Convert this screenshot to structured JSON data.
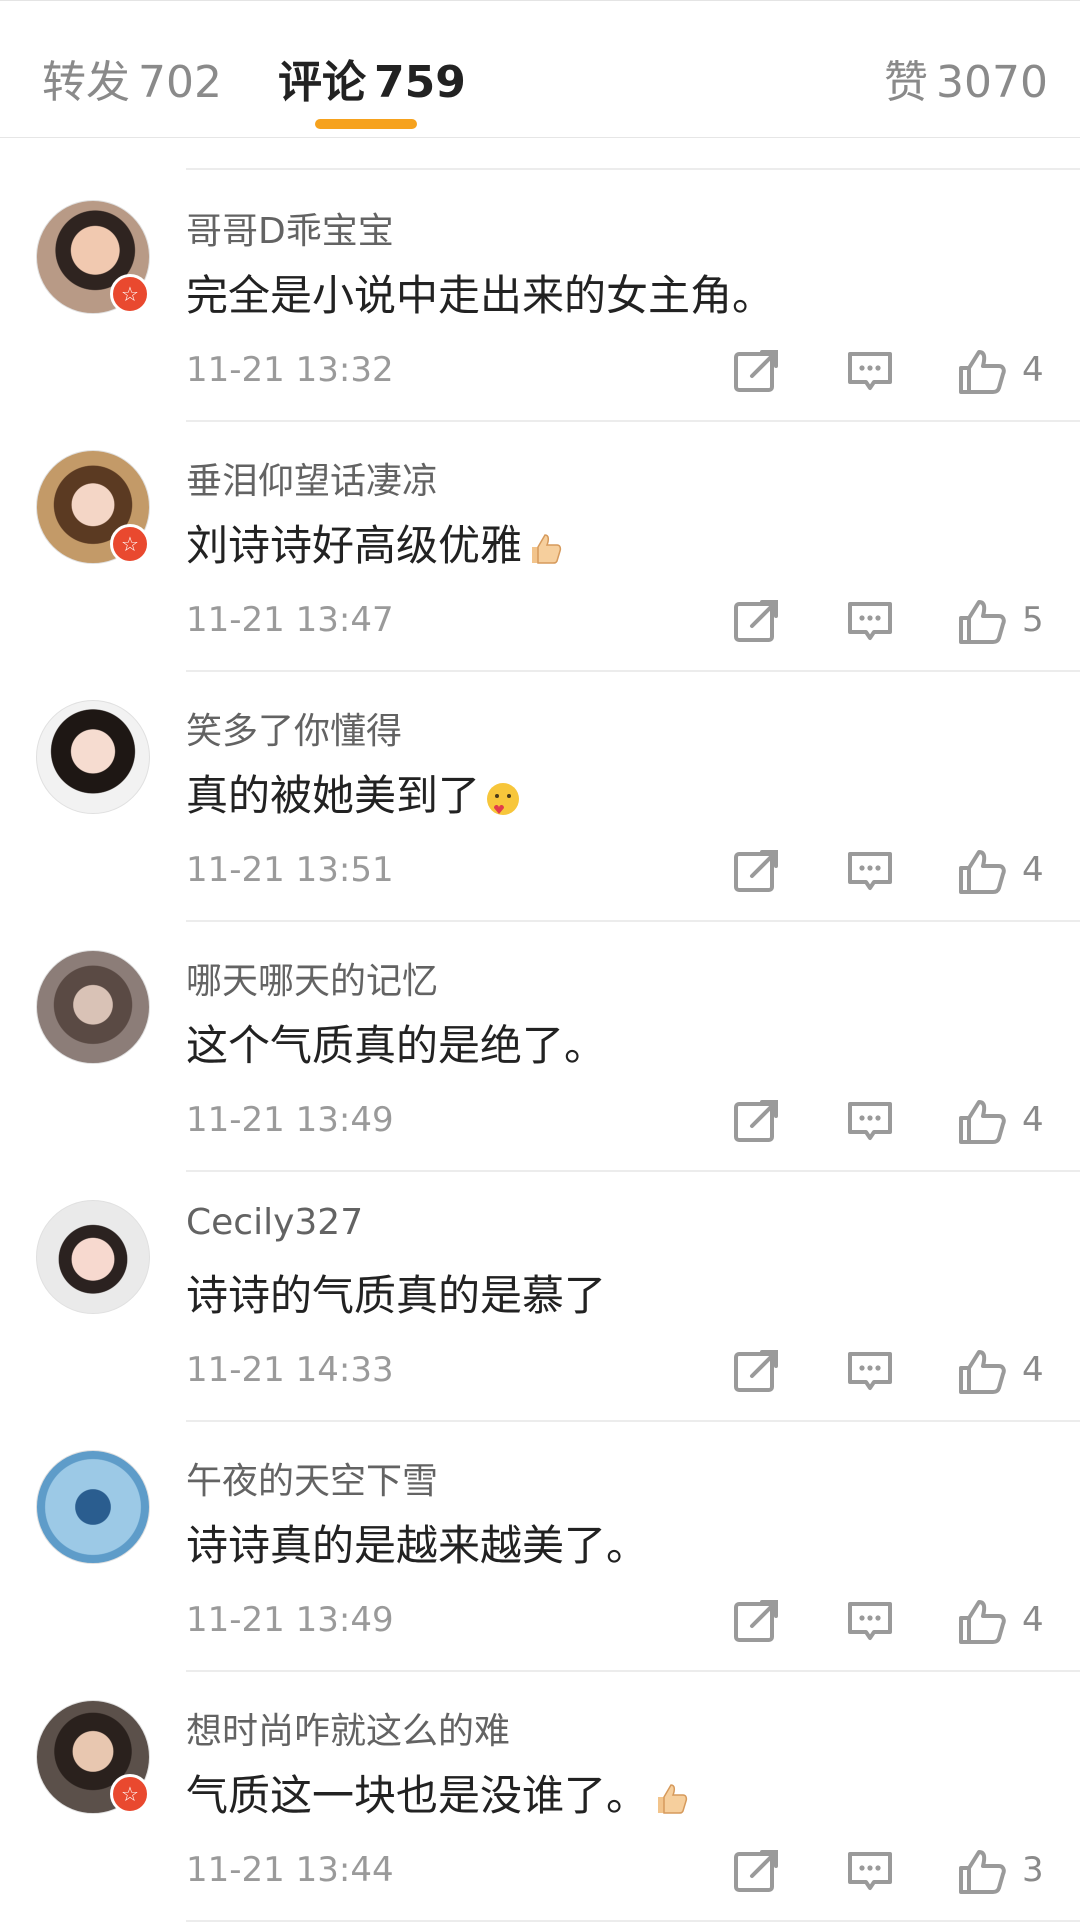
{
  "tabs": [
    {
      "label": "转发",
      "count": "702"
    },
    {
      "label": "评论",
      "count": "759"
    },
    {
      "label": "赞",
      "count": "3070"
    }
  ],
  "colors": {
    "accent": "#f6a21e",
    "badge": "#e9492f",
    "muted": "#9a9a9a"
  },
  "comments": [
    {
      "user": "哥哥D乖宝宝",
      "text": "完全是小说中走出来的女主角。",
      "time": "11-21 13:32",
      "likes": "4",
      "badge": true,
      "emoji": ""
    },
    {
      "user": "垂泪仰望话凄凉",
      "text": "刘诗诗好高级优雅",
      "time": "11-21 13:47",
      "likes": "5",
      "badge": true,
      "emoji": "thumbs-up-emoji"
    },
    {
      "user": "笑多了你懂得",
      "text": "真的被她美到了",
      "time": "11-21 13:51",
      "likes": "4",
      "badge": false,
      "emoji": "heart-face-emoji"
    },
    {
      "user": "哪天哪天的记忆",
      "text": "这个气质真的是绝了。",
      "time": "11-21 13:49",
      "likes": "4",
      "badge": false,
      "emoji": ""
    },
    {
      "user": "Cecily327",
      "text": "诗诗的气质真的是慕了",
      "time": "11-21 14:33",
      "likes": "4",
      "badge": false,
      "emoji": ""
    },
    {
      "user": "午夜的天空下雪",
      "text": "诗诗真的是越来越美了。",
      "time": "11-21 13:49",
      "likes": "4",
      "badge": false,
      "emoji": ""
    },
    {
      "user": "想时尚咋就这么的难",
      "text": "气质这一块也是没谁了。",
      "time": "11-21 13:44",
      "likes": "3",
      "badge": true,
      "emoji": "thumbs-up-emoji"
    }
  ]
}
